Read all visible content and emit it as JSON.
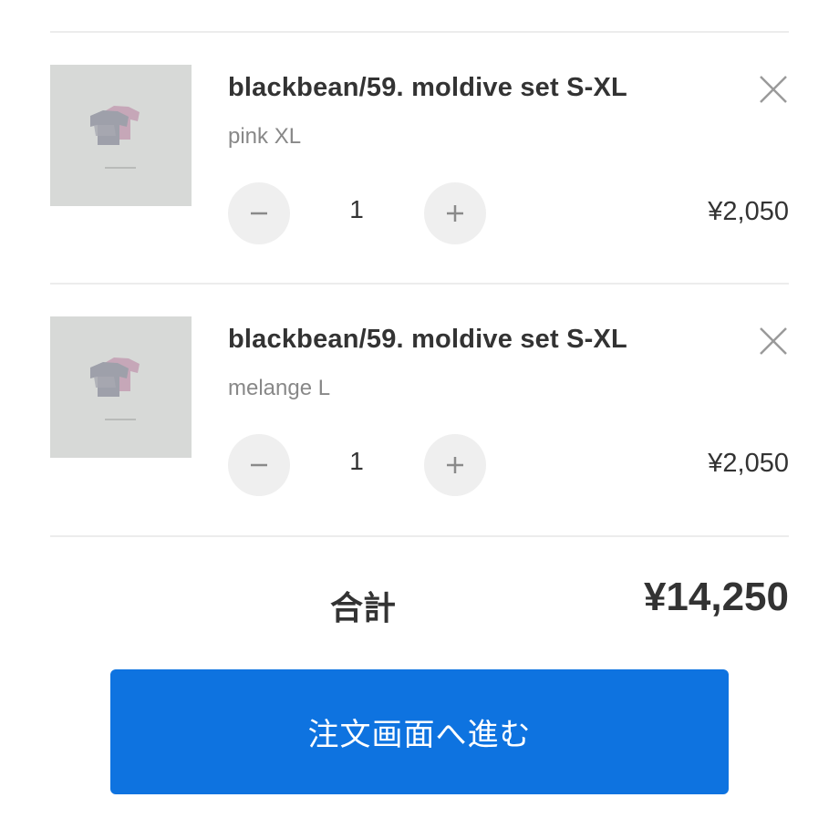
{
  "cart": {
    "items": [
      {
        "title": "blackbean/59. moldive set S-XL",
        "variant": "pink XL",
        "quantity": "1",
        "price": "¥2,050",
        "minus_symbol": "−",
        "plus_symbol": "+",
        "remove_icon": "close-icon",
        "image_caption": "BLACKBEAN"
      },
      {
        "title": "blackbean/59. moldive set S-XL",
        "variant": "melange L",
        "quantity": "1",
        "price": "¥2,050",
        "minus_symbol": "−",
        "plus_symbol": "+",
        "remove_icon": "close-icon",
        "image_caption": "BLACKBEAN"
      }
    ],
    "total_label": "合計",
    "total_value": "¥14,250"
  },
  "checkout": {
    "label": "注文画面へ進む",
    "color": "#0e73e0"
  },
  "colors": {
    "text": "#333333",
    "muted": "#888888",
    "stepper_bg": "#efefef",
    "divider": "#ececec"
  }
}
